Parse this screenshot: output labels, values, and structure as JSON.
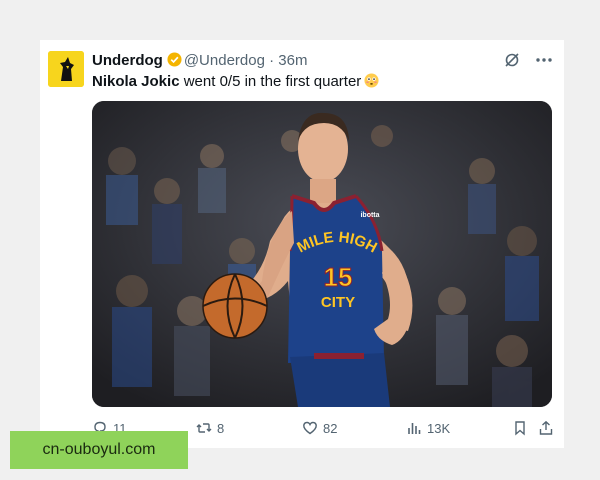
{
  "tweet": {
    "author_name": "Underdog",
    "author_handle": "@Underdog",
    "separator": " · ",
    "time_ago": "36m",
    "text_bold": "Nikola Jokic",
    "text_rest": " went 0/5 in the first quarter",
    "emoji_name": "flushed-face-emoji",
    "verified_color": "#f4b400"
  },
  "photo": {
    "jersey_line1": "MILE HIGH",
    "jersey_number": "15",
    "jersey_line2": "CITY",
    "jersey_sponsor": "ibotta",
    "jersey_color": "#1d428a",
    "accent_color": "#fec524",
    "trim_color": "#8b2131"
  },
  "actions": {
    "replies": "11",
    "retweets": "8",
    "likes": "82",
    "views": "13K"
  },
  "watermark": "cn-ouboyul.com"
}
